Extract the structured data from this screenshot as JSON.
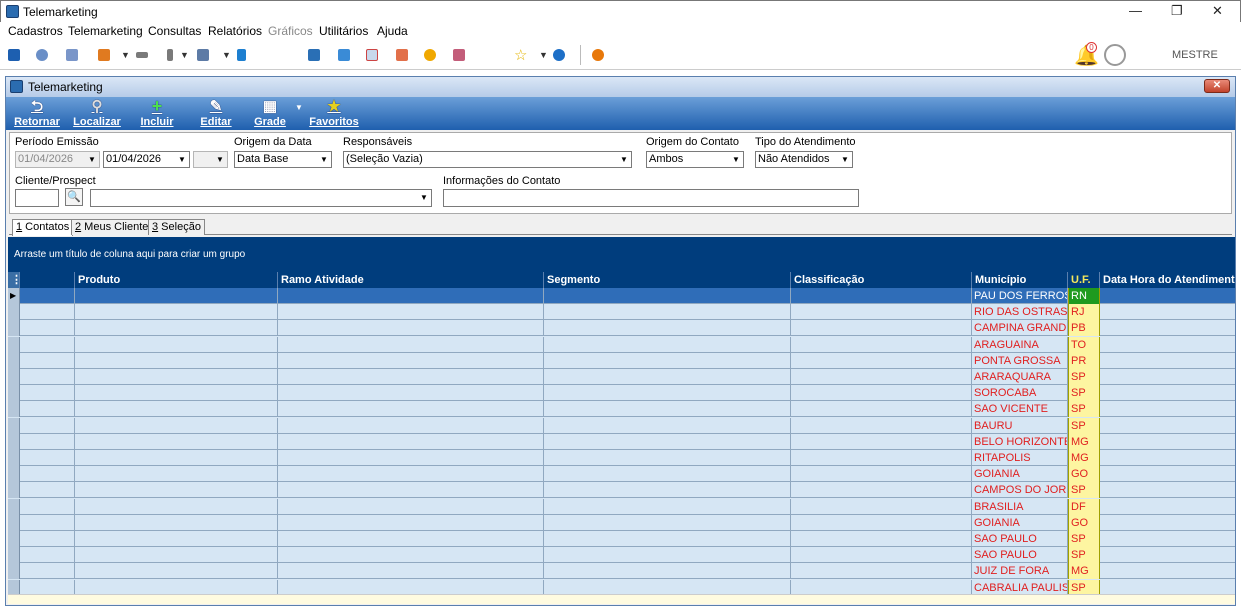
{
  "app": {
    "title": "Telemarketing"
  },
  "window_controls": {
    "minimize": "—",
    "restore": "❐",
    "close": "✕"
  },
  "menu": [
    "Cadastros",
    "Telemarketing",
    "Consultas",
    "Relatórios",
    "Gráficos",
    "Utilitários",
    "Ajuda"
  ],
  "user": {
    "name": "MESTRE",
    "notifications": "0"
  },
  "inner": {
    "title": "Telemarketing",
    "close_label": "✕"
  },
  "toolbar": [
    {
      "label": "Retornar",
      "icon": "return-arrow-icon"
    },
    {
      "label": "Localizar",
      "icon": "magnifier-icon"
    },
    {
      "label": "Incluir",
      "icon": "plus-icon"
    },
    {
      "label": "Editar",
      "icon": "edit-icon"
    },
    {
      "label": "Grade",
      "icon": "grid-icon"
    },
    {
      "label": "Favoritos",
      "icon": "star-icon"
    }
  ],
  "filters": {
    "periodo_label": "Período Emissão",
    "periodo_from": "01/04/2026",
    "periodo_to": "01/04/2026",
    "origem_data_label": "Origem da Data",
    "origem_data_value": "Data Base",
    "responsaveis_label": "Responsáveis",
    "responsaveis_value": "(Seleção Vazia)",
    "origem_contato_label": "Origem do Contato",
    "origem_contato_value": "Ambos",
    "tipo_atendimento_label": "Tipo do Atendimento",
    "tipo_atendimento_value": "Não Atendidos",
    "cliente_label": "Cliente/Prospect",
    "cliente_code": "",
    "cliente_name": "",
    "info_label": "Informações do Contato",
    "info_value": ""
  },
  "tabs": [
    {
      "key": "1",
      "label": " Contatos"
    },
    {
      "key": "2",
      "label": " Meus Clientes"
    },
    {
      "key": "3",
      "label": " Seleção"
    }
  ],
  "group_hint": "Arraste um título de coluna aqui para criar um grupo",
  "grid": {
    "columns": [
      "",
      "Produto",
      "Ramo Atividade",
      "Segmento",
      "Classificação",
      "Município",
      "U.F.",
      "Data Hora do Atendimento"
    ],
    "rows": [
      {
        "municipio": "PAU DOS FERROS",
        "uf": "RN"
      },
      {
        "municipio": "RIO DAS OSTRAS",
        "uf": "RJ"
      },
      {
        "municipio": "CAMPINA GRANDE",
        "uf": "PB"
      },
      {
        "municipio": "ARAGUAINA",
        "uf": "TO"
      },
      {
        "municipio": "PONTA GROSSA",
        "uf": "PR"
      },
      {
        "municipio": "ARARAQUARA",
        "uf": "SP"
      },
      {
        "municipio": "SOROCABA",
        "uf": "SP"
      },
      {
        "municipio": "SAO VICENTE",
        "uf": "SP"
      },
      {
        "municipio": "BAURU",
        "uf": "SP"
      },
      {
        "municipio": "BELO HORIZONTE",
        "uf": "MG"
      },
      {
        "municipio": "RITAPOLIS",
        "uf": "MG"
      },
      {
        "municipio": "GOIANIA",
        "uf": "GO"
      },
      {
        "municipio": "CAMPOS DO JORDAO",
        "uf": "SP"
      },
      {
        "municipio": "BRASILIA",
        "uf": "DF"
      },
      {
        "municipio": "GOIANIA",
        "uf": "GO"
      },
      {
        "municipio": "SAO PAULO",
        "uf": "SP"
      },
      {
        "municipio": "SAO PAULO",
        "uf": "SP"
      },
      {
        "municipio": "JUIZ DE FORA",
        "uf": "MG"
      },
      {
        "municipio": "CABRALIA PAULISTA",
        "uf": "SP"
      }
    ]
  },
  "colors": {
    "accent": "#003d7d",
    "selected_row": "#2f6db8",
    "uf_highlight": "#fdf5a1",
    "municipio_text": "#e02020"
  }
}
